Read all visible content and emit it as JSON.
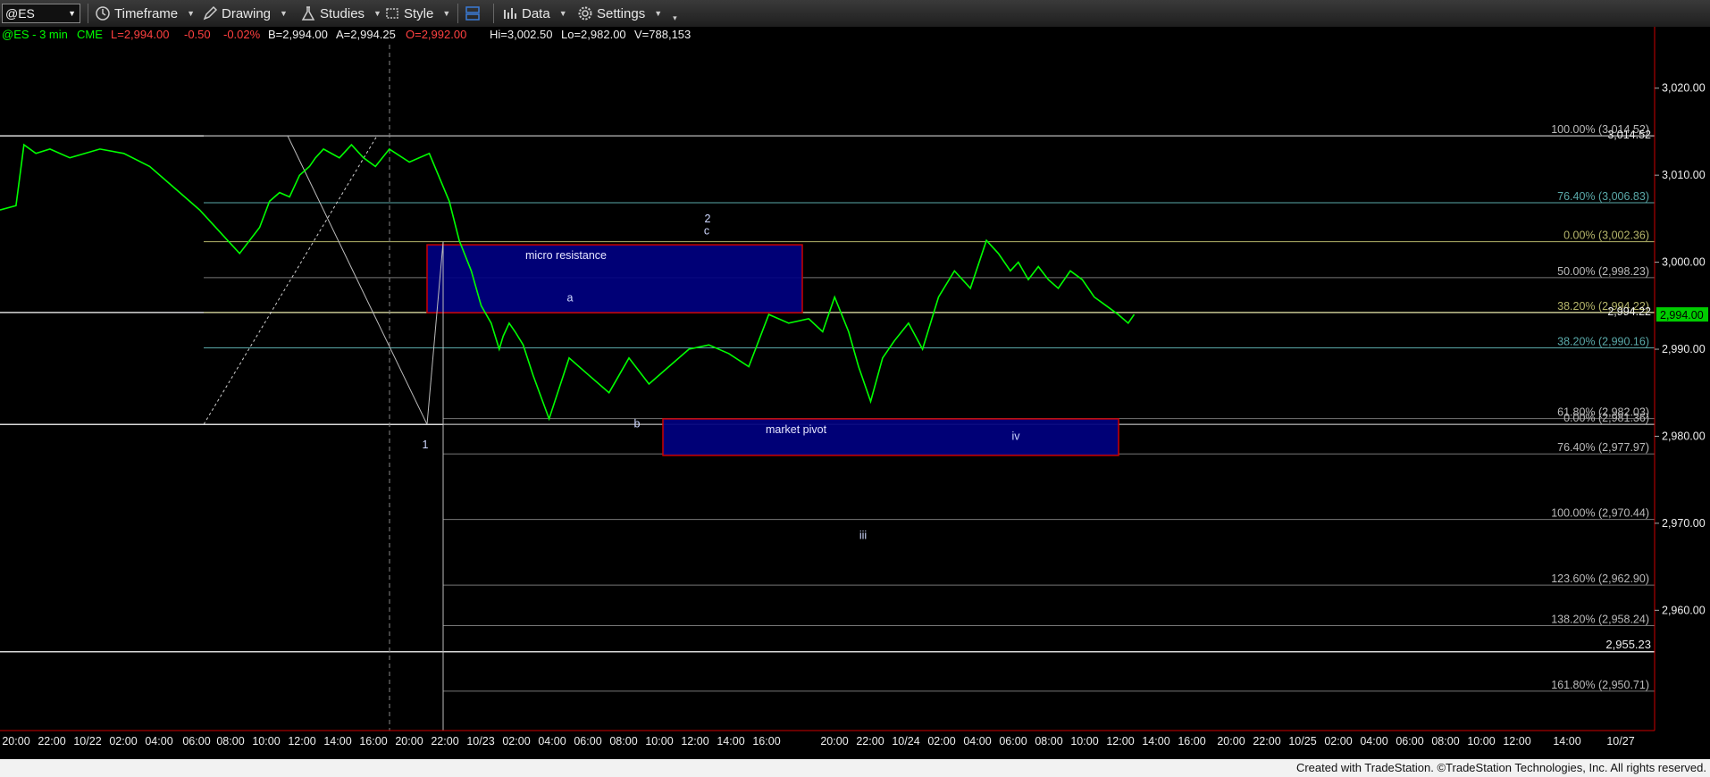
{
  "toolbar": {
    "symbol": "@ES",
    "timeframe_label": "Timeframe",
    "drawing_label": "Drawing",
    "studies_label": "Studies",
    "style_label": "Style",
    "data_label": "Data",
    "settings_label": "Settings"
  },
  "colors": {
    "candles": "#00ff00",
    "box_fill": "#000080",
    "box_border": "#cc0000",
    "price_tag_bg": "#00cc00",
    "axis_border": "#cc0000",
    "fib_teal": "#5aa9a9",
    "fib_olive": "#b5b56a",
    "fib_gray": "#bbbbbb"
  },
  "quote_line": {
    "symbol": "@ES - 3 min",
    "exchange": "CME",
    "last": "L=2,994.00",
    "change": "-0.50",
    "pct": "-0.02%",
    "bid": "B=2,994.00",
    "ask": "A=2,994.25",
    "open": "O=2,992.00",
    "high": "Hi=3,002.50",
    "low": "Lo=2,982.00",
    "volume": "V=788,153"
  },
  "chart_data": {
    "type": "line",
    "title": "@ES - 3 min",
    "ylim": [
      2947,
      3025
    ],
    "y_ticks": [
      "3,020.00",
      "3,010.00",
      "3,000.00",
      "2,990.00",
      "2,980.00",
      "2,970.00",
      "2,960.00"
    ],
    "x_ticks": [
      "20:00",
      "22:00",
      "10/22",
      "02:00",
      "04:00",
      "06:00",
      "08:00",
      "10:00",
      "12:00",
      "14:00",
      "16:00",
      "20:00",
      "22:00",
      "10/23",
      "02:00",
      "04:00",
      "06:00",
      "08:00",
      "10:00",
      "12:00",
      "14:00",
      "16:00",
      "20:00",
      "22:00",
      "10/24",
      "02:00",
      "04:00",
      "06:00",
      "08:00",
      "10:00",
      "12:00",
      "14:00",
      "16:00",
      "20:00",
      "22:00",
      "10/25",
      "02:00",
      "04:00",
      "06:00",
      "08:00",
      "10:00",
      "12:00",
      "14:00",
      "10/27"
    ],
    "price_tag": "2,994.00",
    "series": [
      {
        "name": "price",
        "bar_index": [
          0,
          8,
          12,
          18,
          25,
          35,
          50,
          62,
          75,
          90,
          100,
          108,
          120,
          130,
          135,
          140,
          145,
          150,
          155,
          158,
          162,
          170,
          176,
          182,
          188,
          195,
          205,
          215,
          225,
          230,
          236,
          241,
          246,
          250,
          252,
          255,
          258,
          262,
          267,
          275,
          285,
          295,
          305,
          315,
          325,
          335,
          345,
          355,
          365,
          375,
          385,
          395,
          405,
          412,
          418,
          425,
          430,
          436,
          442,
          448,
          455,
          462,
          470,
          478,
          486,
          494,
          500,
          506,
          510,
          515,
          520,
          525,
          530,
          536,
          542,
          548,
          554,
          560,
          565,
          568
        ],
        "values": [
          3006.0,
          3006.5,
          3013.5,
          3012.5,
          3013.0,
          3012.0,
          3013.0,
          3012.5,
          3011.0,
          3008.0,
          3006.0,
          3004.0,
          3001.0,
          3004.0,
          3007.0,
          3008.0,
          3007.5,
          3010.0,
          3011.0,
          3012.0,
          3013.0,
          3012.0,
          3013.5,
          3012.0,
          3011.0,
          3013.0,
          3011.5,
          3012.5,
          3007.0,
          3002.5,
          2999.0,
          2995.0,
          2993.0,
          2990.0,
          2991.5,
          2993.0,
          2992.0,
          2990.5,
          2987.0,
          2982.0,
          2989.0,
          2987.0,
          2985.0,
          2989.0,
          2986.0,
          2988.0,
          2990.0,
          2990.5,
          2989.5,
          2988.0,
          2994.0,
          2993.0,
          2993.5,
          2992.0,
          2996.0,
          2992.0,
          2988.0,
          2984.0,
          2989.0,
          2991.0,
          2993.0,
          2990.0,
          2996.0,
          2999.0,
          2997.0,
          3002.5,
          3001.0,
          2999.0,
          3000.0,
          2998.0,
          2999.5,
          2998.0,
          2997.0,
          2999.0,
          2998.0,
          2996.0,
          2995.0,
          2994.0,
          2993.0,
          2994.0
        ]
      }
    ],
    "fib_levels": [
      {
        "label": "100.00% (3,014.52)",
        "price": 3014.52,
        "extra": "3,014.52"
      },
      {
        "label": "76.40% (3,006.83)",
        "price": 3006.83
      },
      {
        "label": "0.00% (3,002.36)",
        "price": 3002.36
      },
      {
        "label": "50.00% (2,998.23)",
        "price": 2998.23
      },
      {
        "label": "38.20% (2,994.22)",
        "price": 2994.22,
        "extra": "2,994.22"
      },
      {
        "label": "38.20% (2,990.16)",
        "price": 2990.16
      },
      {
        "label": "61.80% (2,982.03)",
        "price": 2982.03
      },
      {
        "label": "0.00% (2,981.36)",
        "price": 2981.36
      },
      {
        "label": "76.40% (2,977.97)",
        "price": 2977.97
      },
      {
        "label": "100.00% (2,970.44)",
        "price": 2970.44
      },
      {
        "label": "123.60% (2,962.90)",
        "price": 2962.9
      },
      {
        "label": "138.20% (2,958.24)",
        "price": 2958.24
      },
      {
        "label": "161.80% (2,950.71)",
        "price": 2950.71
      }
    ],
    "horizontal_lines": [
      {
        "label": "",
        "price": 3014.52
      },
      {
        "label": "",
        "price": 2994.22
      },
      {
        "label": "2,955.23",
        "price": 2955.23
      },
      {
        "label": "",
        "price": 2981.36
      }
    ],
    "boxes": [
      {
        "label": "micro resistance",
        "price_top": 3002.0,
        "price_bottom": 2994.2
      },
      {
        "label": "market pivot",
        "price_top": 2982.0,
        "price_bottom": 2977.8
      }
    ],
    "wave_labels": [
      "1",
      "a",
      "b",
      "2",
      "c",
      "iv",
      "iii"
    ]
  },
  "footer": {
    "credit": "Created with TradeStation. ©TradeStation Technologies, Inc. All rights reserved."
  }
}
